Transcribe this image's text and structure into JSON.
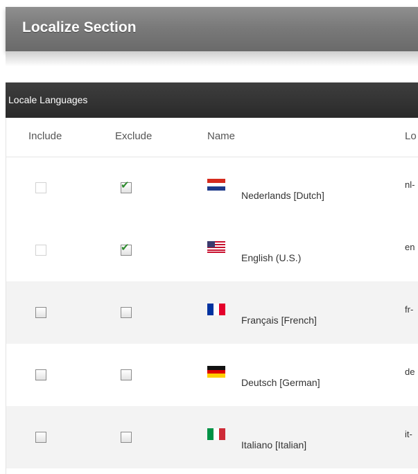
{
  "section": {
    "title": "Localize Section"
  },
  "panel": {
    "title": "Locale Languages"
  },
  "table": {
    "headers": {
      "include": "Include",
      "exclude": "Exclude",
      "name": "Name",
      "code": "Lo"
    },
    "rows": [
      {
        "include": false,
        "include_disabled": true,
        "exclude": true,
        "flag": "netherlands-flag-icon",
        "name": "Nederlands [Dutch]",
        "code": "nl-"
      },
      {
        "include": false,
        "include_disabled": true,
        "exclude": true,
        "flag": "us-flag-icon",
        "name": "English (U.S.)",
        "code": "en"
      },
      {
        "include": false,
        "include_disabled": false,
        "exclude": false,
        "flag": "france-flag-icon",
        "name": "Français [French]",
        "code": "fr-"
      },
      {
        "include": false,
        "include_disabled": false,
        "exclude": false,
        "flag": "germany-flag-icon",
        "name": "Deutsch [German]",
        "code": "de"
      },
      {
        "include": false,
        "include_disabled": false,
        "exclude": false,
        "flag": "italy-flag-icon",
        "name": "Italiano [Italian]",
        "code": "it-"
      }
    ]
  }
}
